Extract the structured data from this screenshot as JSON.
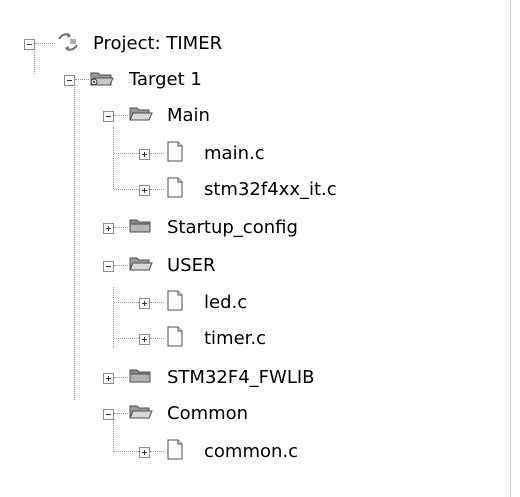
{
  "tree": {
    "project": {
      "label": "Project: TIMER"
    },
    "target": {
      "label": "Target 1"
    },
    "groups": [
      {
        "label": "Main",
        "expanded": true,
        "files": [
          {
            "label": "main.c"
          },
          {
            "label": "stm32f4xx_it.c"
          }
        ]
      },
      {
        "label": "Startup_config",
        "expanded": false,
        "files": []
      },
      {
        "label": "USER",
        "expanded": true,
        "files": [
          {
            "label": "led.c"
          },
          {
            "label": "timer.c"
          }
        ]
      },
      {
        "label": "STM32F4_FWLIB",
        "expanded": false,
        "files": []
      },
      {
        "label": "Common",
        "expanded": true,
        "files": [
          {
            "label": "common.c"
          }
        ]
      }
    ]
  },
  "icons": {
    "project": "project-icon",
    "target": "target-folder-icon",
    "folder_open": "folder-open-icon",
    "folder_closed": "folder-closed-icon",
    "file": "c-file-icon"
  }
}
